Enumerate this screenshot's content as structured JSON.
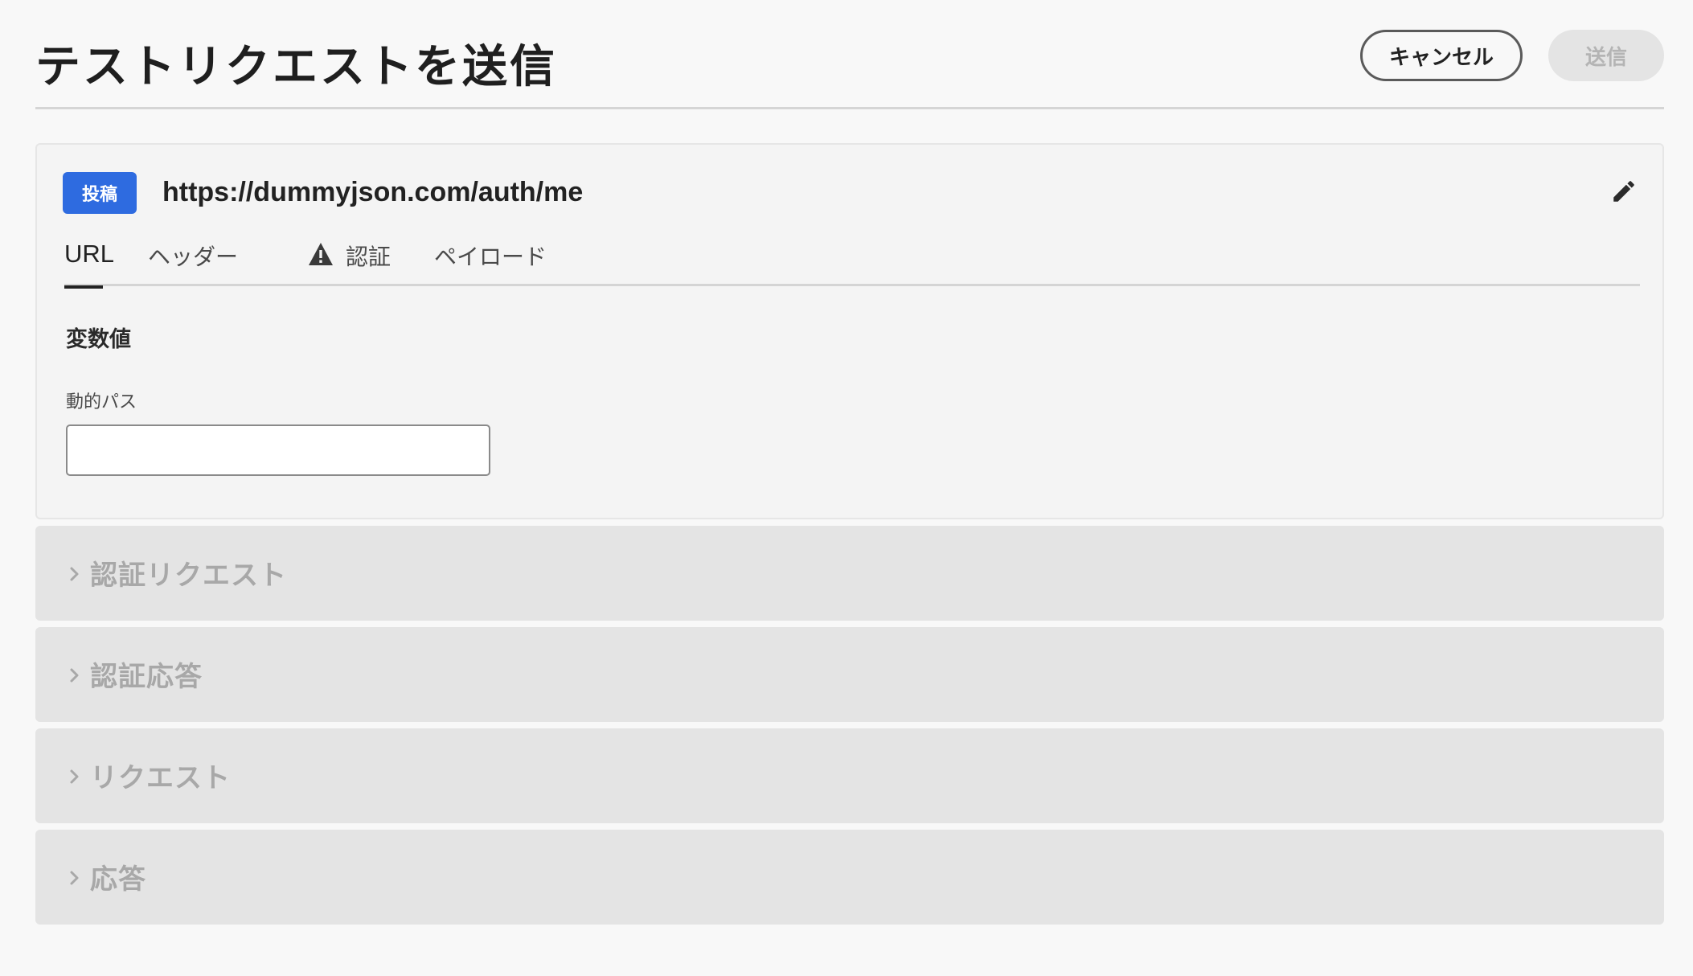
{
  "header": {
    "title": "テストリクエストを送信",
    "cancel_label": "キャンセル",
    "send_label": "送信"
  },
  "request": {
    "method": "投稿",
    "method_color": "#2e6be0",
    "url": "https://dummyjson.com/auth/me",
    "edit_icon": "pencil-icon"
  },
  "tabs": [
    {
      "label": "URL",
      "selected": true
    },
    {
      "label": "ヘッダー",
      "selected": false
    },
    {
      "label": "認証",
      "selected": false,
      "icon": "warning-icon"
    },
    {
      "label": "ペイロード",
      "selected": false
    }
  ],
  "url_panel": {
    "section_title": "変数値",
    "field_label": "動的パス",
    "field_value": "",
    "field_placeholder": ""
  },
  "accordions": [
    {
      "label": "認証リクエスト",
      "expanded": false
    },
    {
      "label": "認証応答",
      "expanded": false
    },
    {
      "label": "リクエスト",
      "expanded": false
    },
    {
      "label": "応答",
      "expanded": false
    }
  ]
}
